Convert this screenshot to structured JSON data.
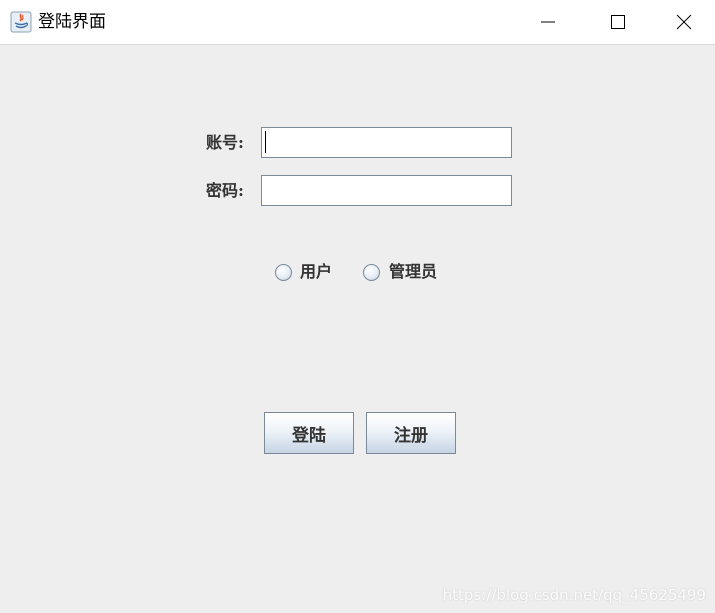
{
  "window": {
    "title": "登陆界面"
  },
  "form": {
    "account_label": "账号:",
    "account_value": "",
    "password_label": "密码:",
    "password_value": ""
  },
  "role": {
    "options": [
      "用户",
      "管理员"
    ]
  },
  "buttons": {
    "login_label": "登陆",
    "register_label": "注册"
  },
  "watermark": "https://blog.csdn.net/qq_45625499",
  "icons": {
    "app": "java-icon",
    "minimize": "minimize-icon",
    "maximize": "maximize-icon",
    "close": "close-icon"
  }
}
